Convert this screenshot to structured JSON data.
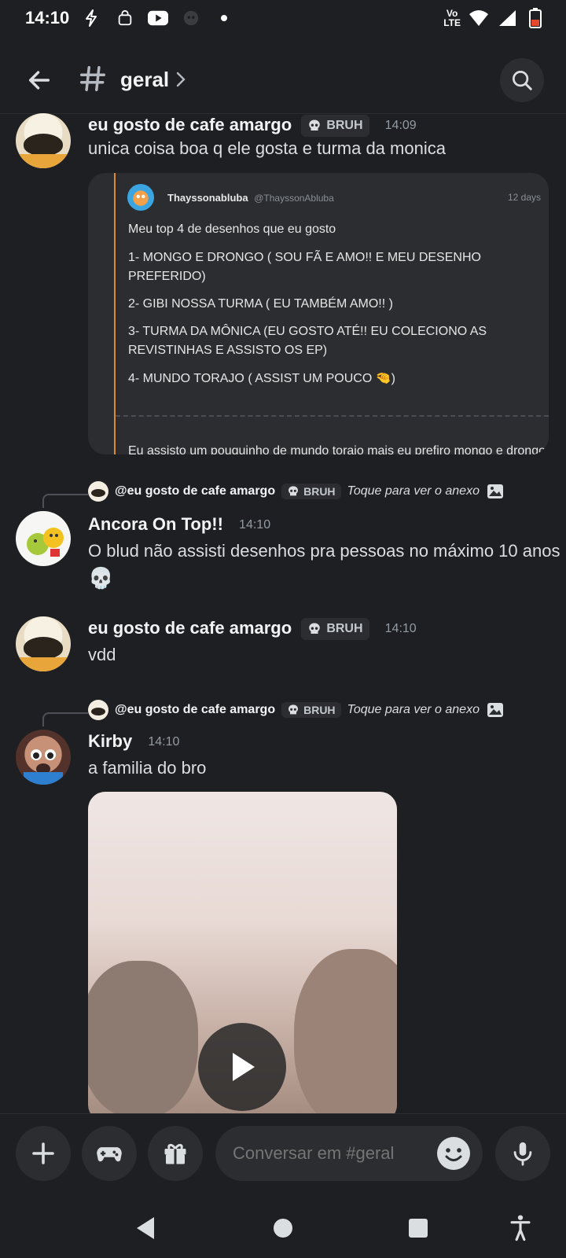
{
  "status_bar": {
    "time": "14:10",
    "icons_left": [
      "lightning-icon",
      "shopping-bag-icon",
      "youtube-icon",
      "game-icon",
      "dot-icon"
    ],
    "volte": "Vo\nLTE",
    "icons_right": [
      "wifi-icon",
      "signal-icon",
      "battery-low-icon"
    ]
  },
  "header": {
    "channel_name": "geral"
  },
  "messages": [
    {
      "author": "eu gosto de cafe amargo",
      "tag": "BRUH",
      "time": "14:09",
      "text": "unica coisa boa q ele gosta e turma da monica"
    },
    {
      "reply_to": "@eu gosto de cafe amargo",
      "reply_tag": "BRUH",
      "reply_hint": "Toque para ver o anexo",
      "author": "Ancora On Top!!",
      "time": "14:10",
      "text": "O blud não assisti desenhos pra pessoas no máximo 10 anos",
      "emoji": "💀"
    },
    {
      "author": "eu gosto de cafe amargo",
      "tag": "BRUH",
      "time": "14:10",
      "text": "vdd"
    },
    {
      "reply_to": "@eu gosto de cafe amargo",
      "reply_tag": "BRUH",
      "reply_hint": "Toque para ver o anexo",
      "author": "Kirby",
      "time": "14:10",
      "text": "a familia do bro"
    }
  ],
  "embed": {
    "name": "Thayssonabluba",
    "handle": "@ThayssonAbluba",
    "days": "12 days",
    "lines": [
      "Meu top 4 de desenhos que eu gosto",
      "1- MONGO E DRONGO ( SOU FÃ E AMO!! E MEU DESENHO PREFERIDO)",
      "2- GIBI NOSSA TURMA ( EU TAMBÉM AMO!! )",
      "3- TURMA DA MÔNICA (EU GOSTO ATÉ!! EU COLECIONO AS REVISTINHAS E ASSISTO OS EP)",
      "4- MUNDO TORAJO ( ASSIST UM POUCO 🤏)",
      "Eu assisto um pouquinho de mundo torajo mais eu prefiro mongo e drongo e"
    ]
  },
  "composer": {
    "placeholder": "Conversar em #geral"
  },
  "colors": {
    "background": "#1e1f22",
    "surface": "#2b2d31",
    "embed_accent": "#e08a2c"
  }
}
